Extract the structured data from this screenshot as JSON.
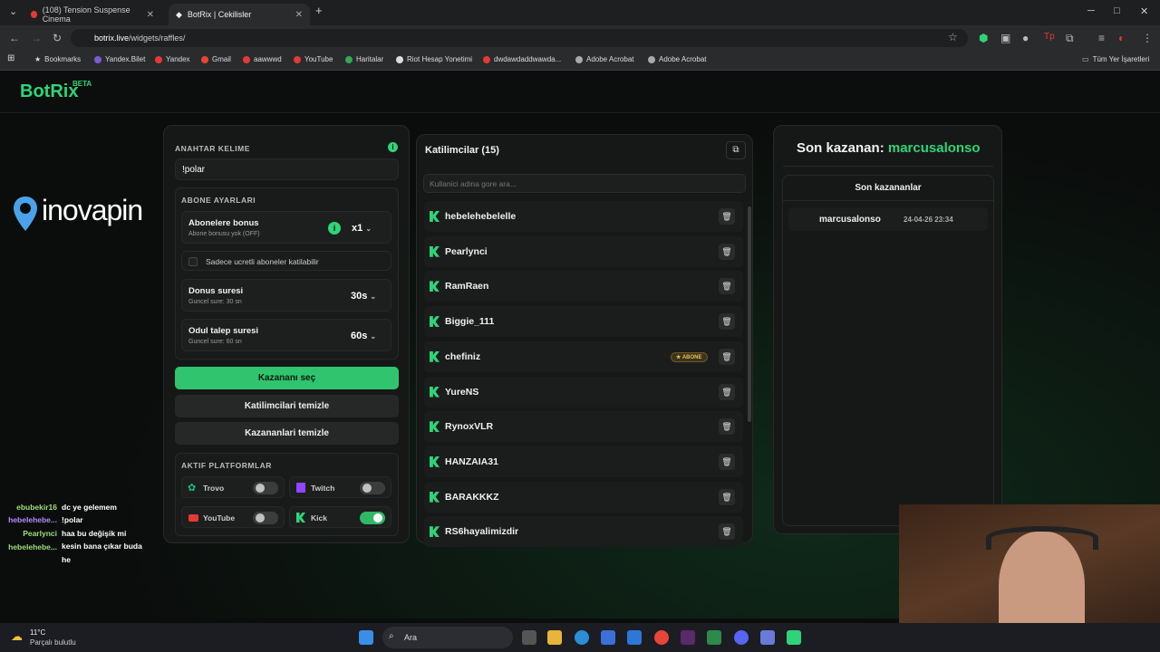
{
  "browser": {
    "tabs": [
      {
        "label": "(108) Tension Suspense Cinema"
      },
      {
        "label": "BotRix | Cekilisler"
      }
    ],
    "url_host": "botrix.live",
    "url_path": "/widgets/raffles/",
    "bookmarks": [
      "Bookmarks",
      "Yandex.Bilet",
      "Yandex",
      "Gmail",
      "aawwwd",
      "YouTube",
      "Haritalar",
      "Riot Hesap Yonetimi",
      "dwdawdaddwawda...",
      "Adobe Acrobat",
      "Adobe Acrobat"
    ],
    "all_bookmarks": "Tüm Yer İşaretleri"
  },
  "app": {
    "logo": "BotRix",
    "beta": "BETA",
    "overlay_logo": "inovapin"
  },
  "settings": {
    "keyword_label": "ANAHTAR KELIME",
    "keyword_value": "!polar",
    "sub_label": "ABONE AYARLARI",
    "sub_bonus_title": "Abonelere bonus",
    "sub_bonus_sub": "Abone bonusu yok (OFF)",
    "sub_bonus_value": "x1",
    "only_paid": "Sadece ucretli aboneler katilabilir",
    "spin_title": "Donus suresi",
    "spin_sub": "Guncel sure: 30 sn",
    "spin_value": "30s",
    "claim_title": "Odul talep suresi",
    "claim_sub": "Guncel sure: 60 sn",
    "claim_value": "60s",
    "pick_btn": "Kazananı seç",
    "clear_participants": "Katilimcilari temizle",
    "clear_winners": "Kazananlari temizle",
    "platforms_label": "AKTIF PLATFORMLAR",
    "platforms": [
      {
        "name": "Trovo",
        "on": false
      },
      {
        "name": "Twitch",
        "on": false
      },
      {
        "name": "YouTube",
        "on": false
      },
      {
        "name": "Kick",
        "on": true
      }
    ]
  },
  "participants": {
    "title": "Katilimcilar (15)",
    "search_placeholder": "Kullanici adina gore ara...",
    "badge": "ABONE",
    "list": [
      "hebelehebelelle",
      "Pearlynci",
      "RamRaen",
      "Biggie_111",
      "chefiniz",
      "YureNS",
      "RynoxVLR",
      "HANZAIA31",
      "BARAKKKZ",
      "RS6hayalimizdir"
    ]
  },
  "winners": {
    "prefix": "Son kazanan:",
    "last": "marcusalonso",
    "list_title": "Son kazananlar",
    "rows": [
      {
        "name": "marcusalonso",
        "time": "24-04-26 23:34"
      }
    ]
  },
  "chat": [
    {
      "user": "ebubekir16",
      "msg": "dc ye gelemem"
    },
    {
      "user": "hebelehebe...",
      "msg": "!polar"
    },
    {
      "user": "Pearlynci",
      "msg": "haa bu değişik mi"
    },
    {
      "user": "",
      "msg": "kesin bana çıkar buda"
    },
    {
      "user": "hebelehebe...",
      "msg": ""
    },
    {
      "user": "",
      "msg": "he"
    }
  ],
  "taskbar": {
    "temp": "11°C",
    "weather": "Parçalı bulutlu",
    "search": "Ara"
  },
  "colors": {
    "accent": "#2fd47a",
    "bg": "#0b0d0c"
  }
}
